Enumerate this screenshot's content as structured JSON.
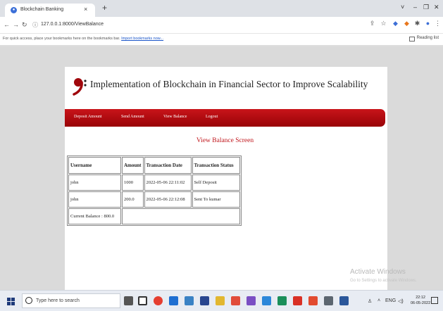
{
  "browser": {
    "tab_title": "Blockchain Banking",
    "tab_close": "×",
    "new_tab": "+",
    "url": "127.0.0.1:8000/ViewBalance",
    "window_controls": [
      "˅",
      "–",
      "❐",
      "✕"
    ],
    "bookmarks_hint": "For quick access, place your bookmarks here on the bookmarks bar.",
    "bookmarks_link": "Import bookmarks now...",
    "reading_list": "Reading list"
  },
  "site": {
    "title": "Implementation of Blockchain in Financial Sector to Improve Scalability",
    "menu": [
      "Deposit Amount",
      "Send Amount",
      "View Balance",
      "Logout"
    ],
    "screen_title": "View Balance Screen"
  },
  "table": {
    "headers": [
      "Username",
      "Amount",
      "Transaction Date",
      "Transaction Status"
    ],
    "rows": [
      [
        "john",
        "1000",
        "2022-05-06 22:11:02",
        "Self Deposit"
      ],
      [
        "john",
        "200.0",
        "2022-05-06 22:12:08",
        "Sent To kumar"
      ]
    ],
    "balance_label": "Current Balance : 800.0"
  },
  "os": {
    "watermark_title": "Activate Windows",
    "watermark_sub": "Go to Settings to activate Windows.",
    "search_placeholder": "Type here to search",
    "time": "22:12",
    "date": "06-05-2022"
  },
  "colors": {
    "menubar": "#b00d12",
    "screen_title": "#c0141a"
  }
}
